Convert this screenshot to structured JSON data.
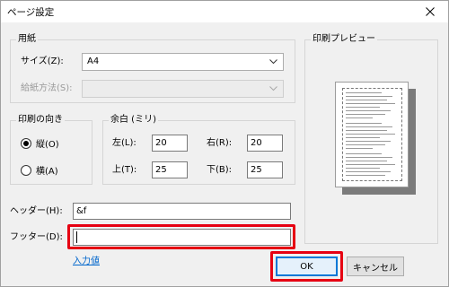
{
  "window": {
    "title": "ページ設定",
    "close_icon": "close-icon"
  },
  "paper": {
    "group_label": "用紙",
    "size_label": "サイズ(Z):",
    "size_value": "A4",
    "feed_label": "給紙方法(S):",
    "feed_value": ""
  },
  "preview": {
    "label": "印刷プレビュー"
  },
  "orientation": {
    "group_label": "印刷の向き",
    "portrait_label": "縦(O)",
    "landscape_label": "横(A)",
    "selected": "portrait"
  },
  "margins": {
    "group_label": "余白 (ミリ)",
    "left_label": "左(L):",
    "left_value": "20",
    "right_label": "右(R):",
    "right_value": "20",
    "top_label": "上(T):",
    "top_value": "25",
    "bottom_label": "下(B):",
    "bottom_value": "25"
  },
  "header": {
    "label": "ヘッダー(H):",
    "value": "&f"
  },
  "footer": {
    "label": "フッター(D):",
    "value": ""
  },
  "links": {
    "input_values": "入力値"
  },
  "buttons": {
    "ok": "OK",
    "cancel": "キャンセル"
  },
  "colors": {
    "highlight": "#e60012",
    "link": "#0066cc",
    "default_button_border": "#0078d7"
  }
}
